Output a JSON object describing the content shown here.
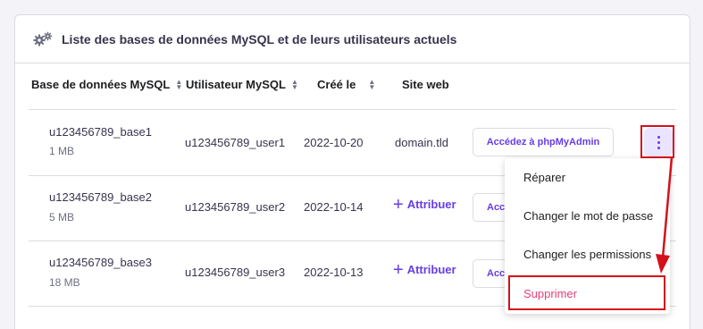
{
  "card": {
    "title": "Liste des bases de données MySQL et de leurs utilisateurs actuels",
    "header_icon": "gears-icon"
  },
  "columns": [
    {
      "label": "Base de données MySQL",
      "sortable": true
    },
    {
      "label": "Utilisateur MySQL",
      "sortable": true
    },
    {
      "label": "Créé le",
      "sortable": true
    },
    {
      "label": "Site web",
      "sortable": false
    }
  ],
  "rows": [
    {
      "db": "u123456789_base1",
      "size": "1 MB",
      "user": "u123456789_user1",
      "created": "2022-10-20",
      "website": "domain.tld",
      "action": "Accédez à phpMyAdmin"
    },
    {
      "db": "u123456789_base2",
      "size": "5 MB",
      "user": "u123456789_user2",
      "created": "2022-10-14",
      "website": "+ Attribuer",
      "action": "Accédez à phpMyAdmin"
    },
    {
      "db": "u123456789_base3",
      "size": "18 MB",
      "user": "u123456789_user3",
      "created": "2022-10-13",
      "website": "+ Attribuer",
      "action": "Accédez à phpMyAdmin"
    }
  ],
  "assign_label": "Attribuer",
  "assign_plus": "+",
  "action_menu": {
    "icon": "kebab-menu-icon",
    "items": [
      {
        "label": "Réparer"
      },
      {
        "label": "Changer le mot de passe"
      },
      {
        "label": "Changer les permissions"
      },
      {
        "label": "Supprimer",
        "danger": true
      }
    ]
  },
  "colors": {
    "accent": "#673de6",
    "danger": "#e53f77",
    "annotation": "#d4101b"
  }
}
